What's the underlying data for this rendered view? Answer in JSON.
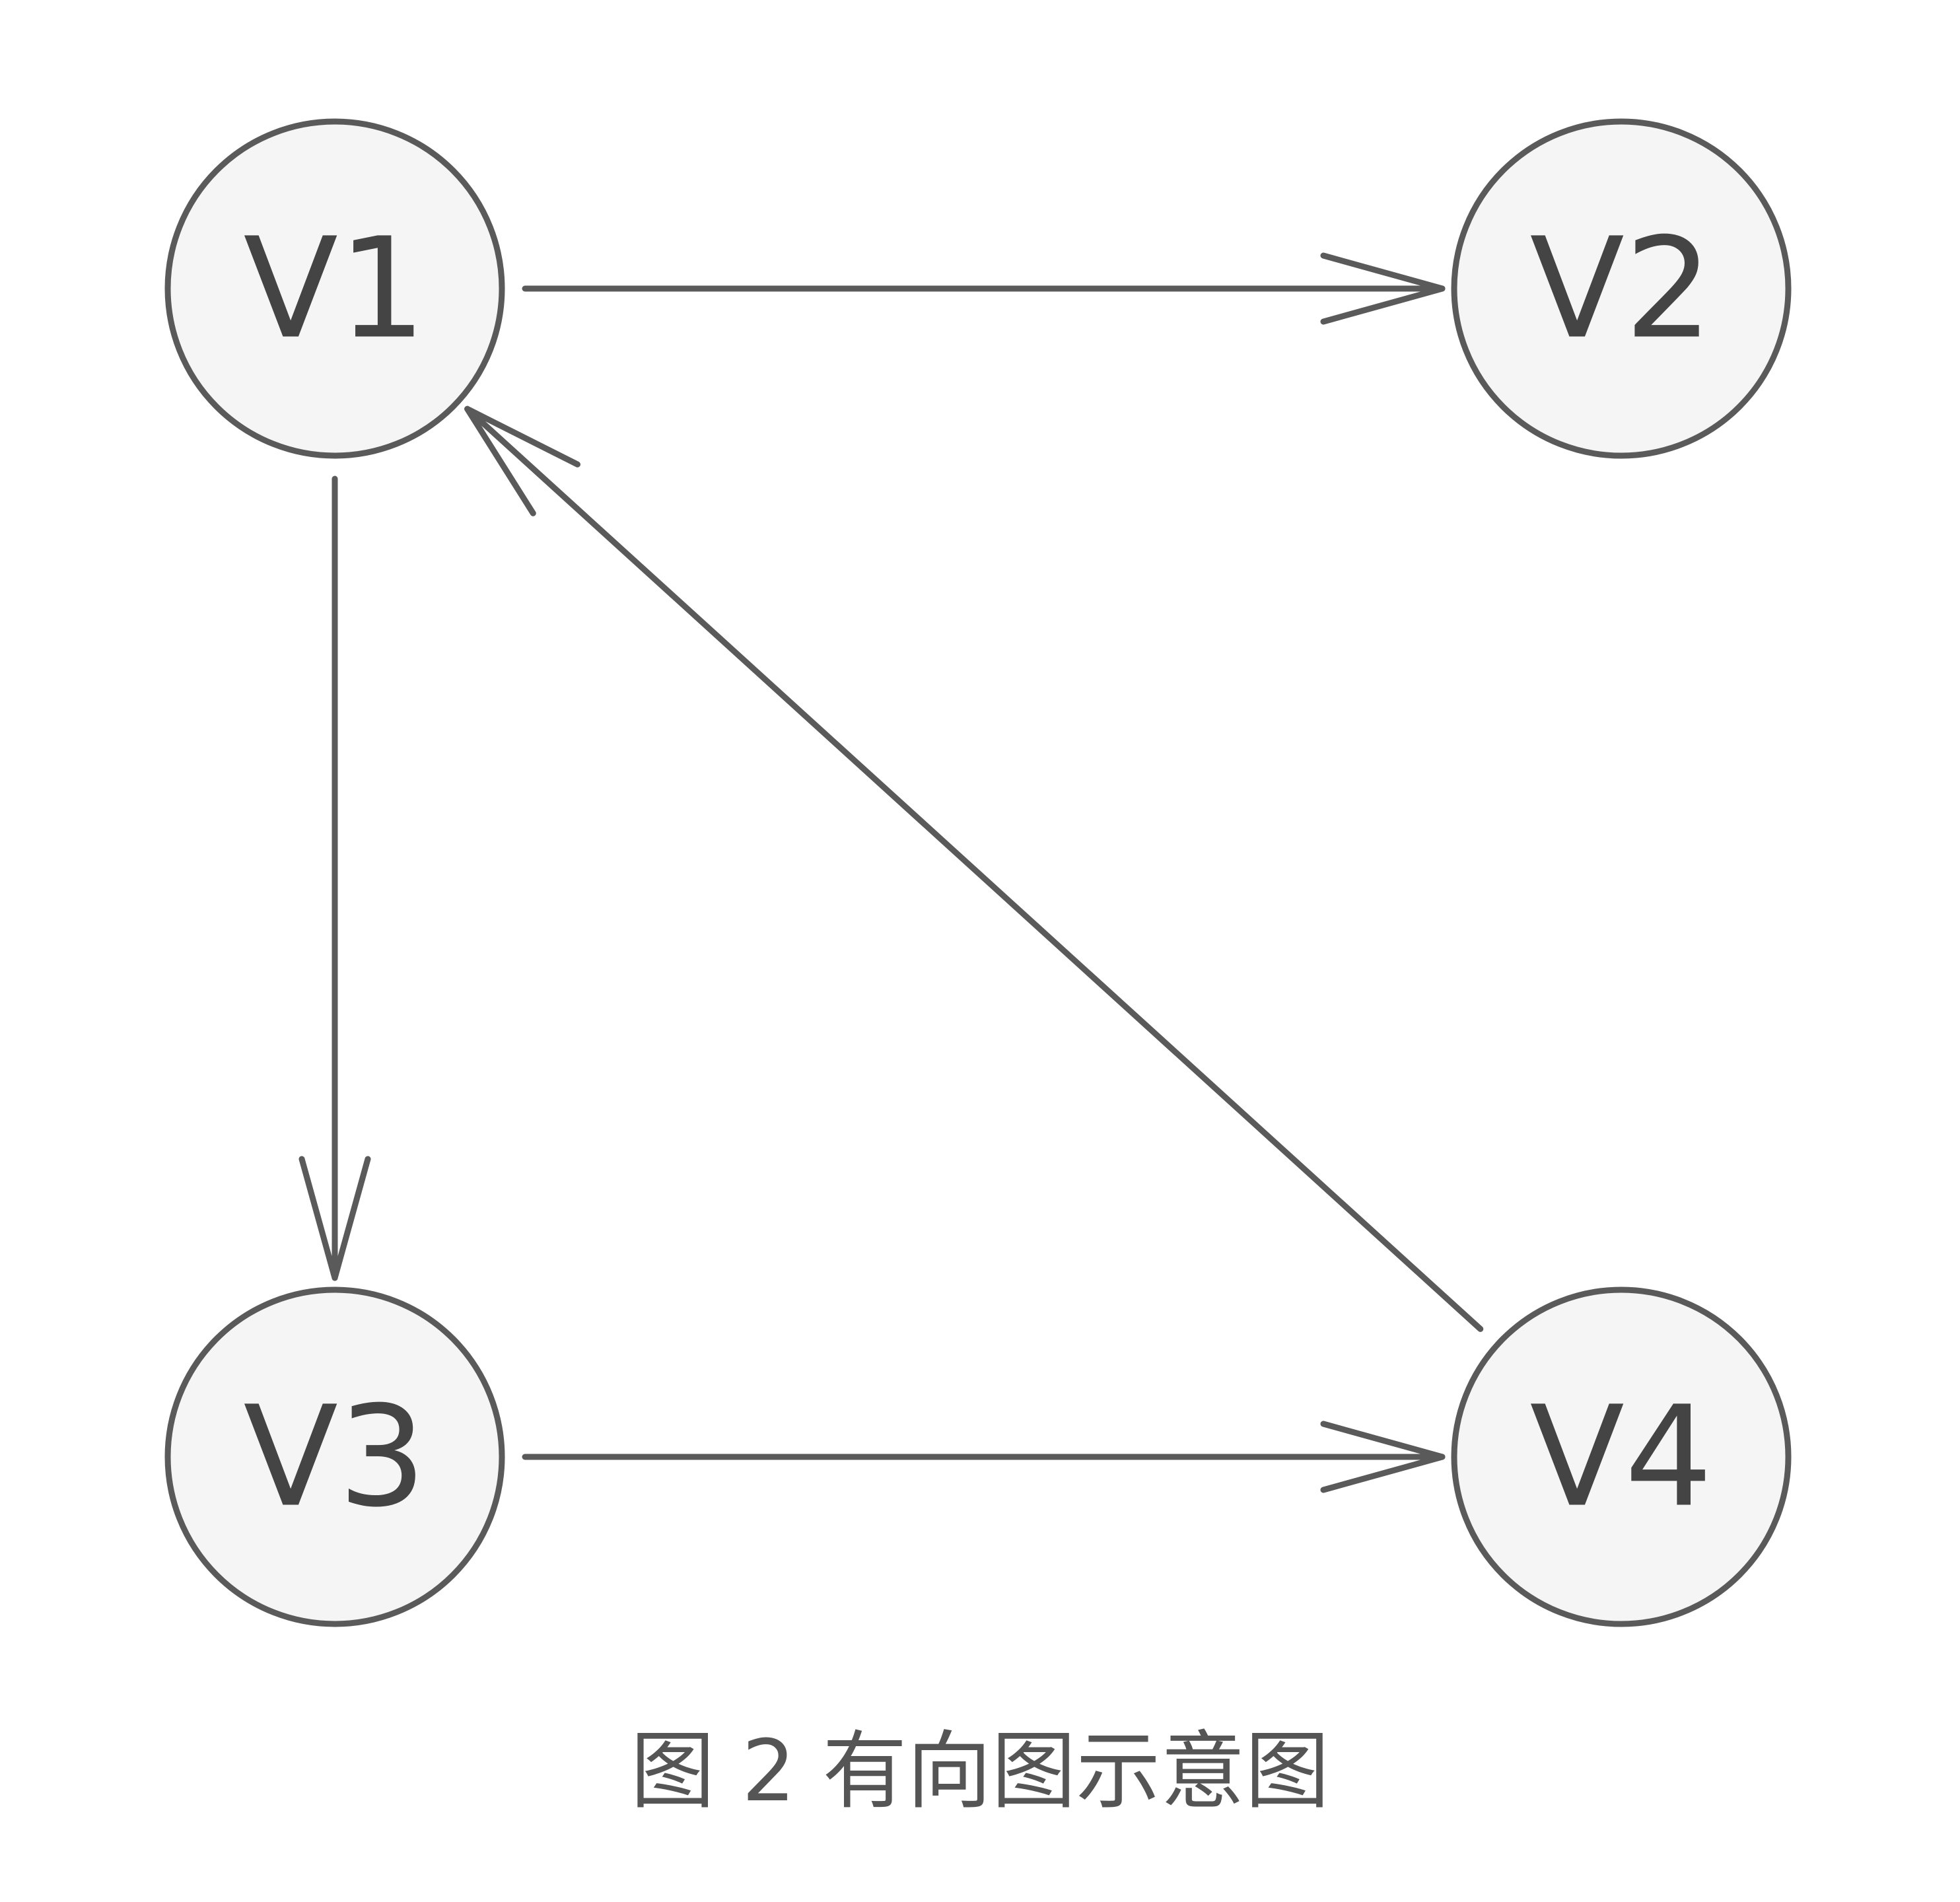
{
  "diagram": {
    "type": "directed-graph",
    "nodes": [
      {
        "id": "V1",
        "label": "V1"
      },
      {
        "id": "V2",
        "label": "V2"
      },
      {
        "id": "V3",
        "label": "V3"
      },
      {
        "id": "V4",
        "label": "V4"
      }
    ],
    "edges": [
      {
        "from": "V1",
        "to": "V2"
      },
      {
        "from": "V1",
        "to": "V3"
      },
      {
        "from": "V3",
        "to": "V4"
      },
      {
        "from": "V4",
        "to": "V1"
      }
    ],
    "caption": "图 2 有向图示意图"
  }
}
